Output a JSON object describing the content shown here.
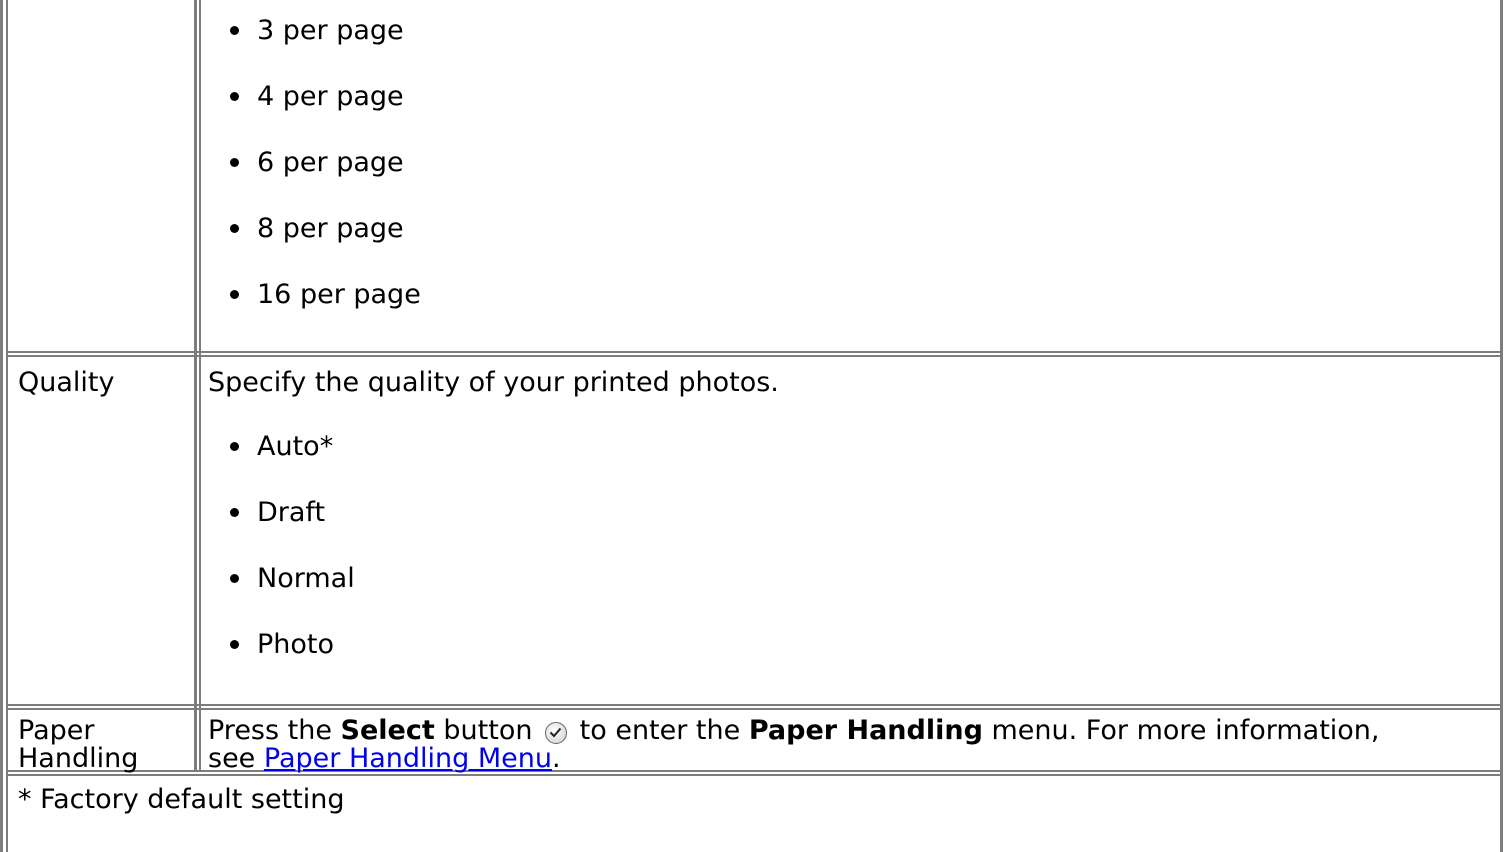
{
  "layout_rows": {
    "row1": {
      "options": [
        "3 per page",
        "4 per page",
        "6 per page",
        "8 per page",
        "16 per page"
      ]
    },
    "quality": {
      "label": "Quality",
      "description": "Specify the quality of your printed photos.",
      "options": [
        "Auto*",
        "Draft",
        "Normal",
        "Photo"
      ]
    },
    "paper_handling": {
      "label_line1": "Paper",
      "label_line2": "Handling",
      "text_press": "Press the",
      "text_select": "Select",
      "text_button": "button",
      "text_to_enter": "to enter the",
      "text_menu_name": "Paper Handling",
      "text_menu_rest": "menu. For more information,",
      "text_see": "see",
      "link_text": "Paper Handling Menu",
      "text_period": "."
    }
  },
  "footnote": "* Factory default setting",
  "icons": {
    "select_button": "select-button-icon",
    "bullet": "bullet-icon"
  },
  "colors": {
    "border": "#7d7d7d",
    "link": "#0000ee"
  }
}
